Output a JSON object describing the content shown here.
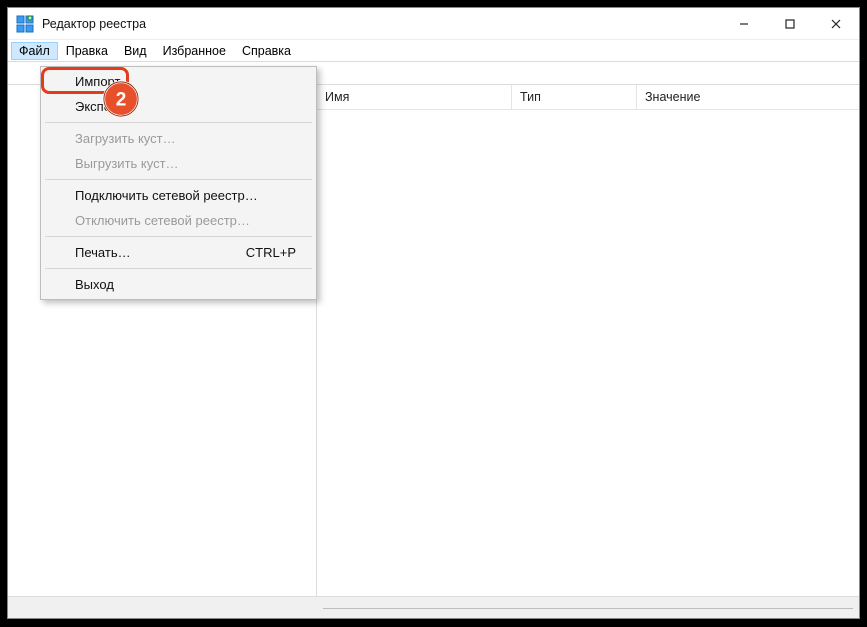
{
  "window": {
    "title": "Редактор реестра"
  },
  "menubar": {
    "items": [
      "Файл",
      "Правка",
      "Вид",
      "Избранное",
      "Справка"
    ],
    "active_index": 0
  },
  "addressbar": {
    "value": ""
  },
  "list_columns": {
    "name": "Имя",
    "type": "Тип",
    "value": "Значение"
  },
  "file_menu": {
    "import": "Импорт…",
    "export": "Экспорт…",
    "load_hive": "Загрузить куст…",
    "unload_hive": "Выгрузить куст…",
    "connect_network": "Подключить сетевой реестр…",
    "disconnect_network": "Отключить сетевой реестр…",
    "print": "Печать…",
    "print_shortcut": "CTRL+P",
    "exit": "Выход"
  },
  "annotation": {
    "step_number": "2"
  }
}
